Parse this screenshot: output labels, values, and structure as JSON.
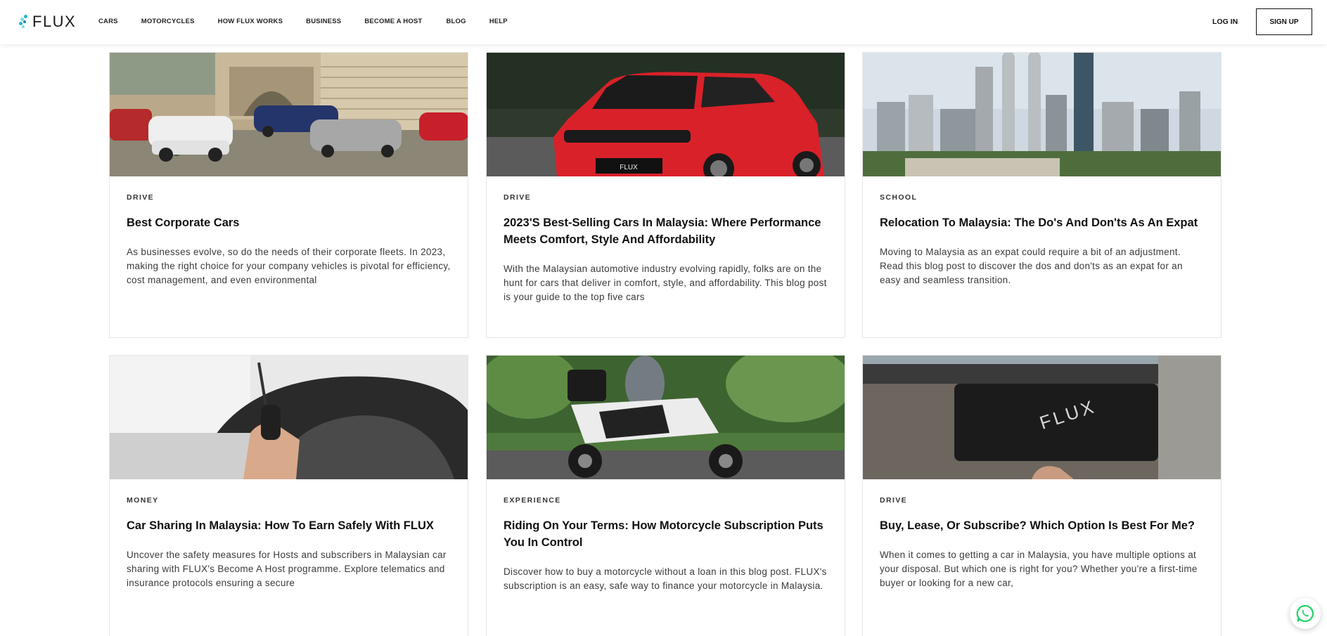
{
  "brand": {
    "name": "FLUX",
    "accent": "#1fb5c9"
  },
  "nav": {
    "items": [
      "CARS",
      "MOTORCYCLES",
      "HOW FLUX WORKS",
      "BUSINESS",
      "BECOME A HOST",
      "BLOG",
      "HELP"
    ],
    "login": "LOG IN",
    "signup": "SIGN UP"
  },
  "posts": [
    {
      "category": "DRIVE",
      "title": "Best Corporate Cars",
      "excerpt": "As businesses evolve, so do the needs of their corporate fleets. In 2023, making the right choice for your company vehicles is pivotal for efficiency, cost management, and even environmental",
      "image": "luxury-cars-photo"
    },
    {
      "category": "DRIVE",
      "title": "2023'S Best-Selling Cars In Malaysia: Where Performance Meets Comfort, Style And Affordability",
      "excerpt": "With the Malaysian automotive industry evolving rapidly, folks are on the hunt for cars that deliver in comfort, style, and affordability. This blog post is your guide to the top five cars",
      "image": "red-car-photo",
      "plate_text": "FLUX"
    },
    {
      "category": "SCHOOL",
      "title": "Relocation To Malaysia: The Do's And Don'ts As An Expat",
      "excerpt": "Moving to Malaysia as an expat could require a bit of an adjustment. Read this blog post to discover the dos and don'ts as an expat for an easy and seamless transition.",
      "image": "city-skyline-photo"
    },
    {
      "category": "MONEY",
      "title": "Car Sharing In Malaysia: How To Earn Safely With FLUX",
      "excerpt": "Uncover the safety measures for Hosts and subscribers in Malaysian car sharing with FLUX's Become A Host programme. Explore telematics and insurance protocols ensuring a secure",
      "image": "car-key-photo"
    },
    {
      "category": "EXPERIENCE",
      "title": "Riding On Your Terms: How Motorcycle Subscription Puts You In Control",
      "excerpt": "Discover how to buy a motorcycle without a loan in this blog post. FLUX's subscription is an easy, safe way to finance your motorcycle in Malaysia.",
      "image": "motorcycle-photo"
    },
    {
      "category": "DRIVE",
      "title": "Buy, Lease, Or Subscribe? Which Option Is Best For Me?",
      "excerpt": "When it comes to getting a car in Malaysia, you have multiple options at your disposal. But which one is right for you? Whether you're a first-time buyer or looking for a new car,",
      "image": "car-plate-photo",
      "plate_text": "FLUX"
    }
  ],
  "whatsapp": {
    "icon": "whatsapp-icon",
    "color": "#25d366"
  }
}
